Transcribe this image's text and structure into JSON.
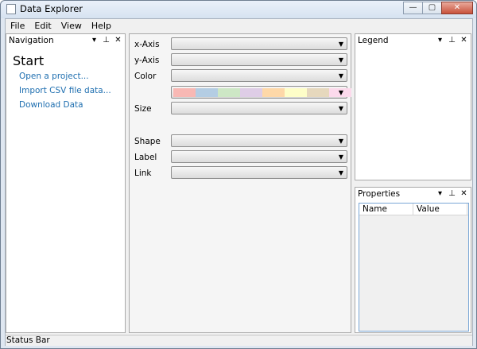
{
  "window": {
    "title": "Data Explorer",
    "buttons": {
      "minimize": "—",
      "maximize": "▢",
      "close": "✕"
    }
  },
  "menu": {
    "items": [
      "File",
      "Edit",
      "View",
      "Help"
    ]
  },
  "navigation": {
    "title": "Navigation",
    "tools": {
      "dropdown": "▾",
      "pin": "⊥",
      "close": "✕"
    },
    "start_label": "Start",
    "links": [
      "Open a project...",
      "Import CSV file data...",
      "Download Data"
    ]
  },
  "fields": {
    "x_axis": "x-Axis",
    "y_axis": "y-Axis",
    "color": "Color",
    "size": "Size",
    "shape": "Shape",
    "label": "Label",
    "link": "Link",
    "combo_arrow": "▼"
  },
  "palette": [
    "#f8b8b4",
    "#b4cde3",
    "#cde7c5",
    "#decde6",
    "#fed8a8",
    "#fefec8",
    "#e6d8bd",
    "#fcdaec"
  ],
  "legend": {
    "title": "Legend",
    "tools": {
      "dropdown": "▾",
      "pin": "⊥",
      "close": "✕"
    }
  },
  "properties": {
    "title": "Properties",
    "tools": {
      "dropdown": "▾",
      "pin": "⊥",
      "close": "✕"
    },
    "columns": [
      "Name",
      "Value"
    ]
  },
  "status": {
    "text": "Status Bar"
  },
  "slider": {
    "value_fraction": 0.1
  }
}
